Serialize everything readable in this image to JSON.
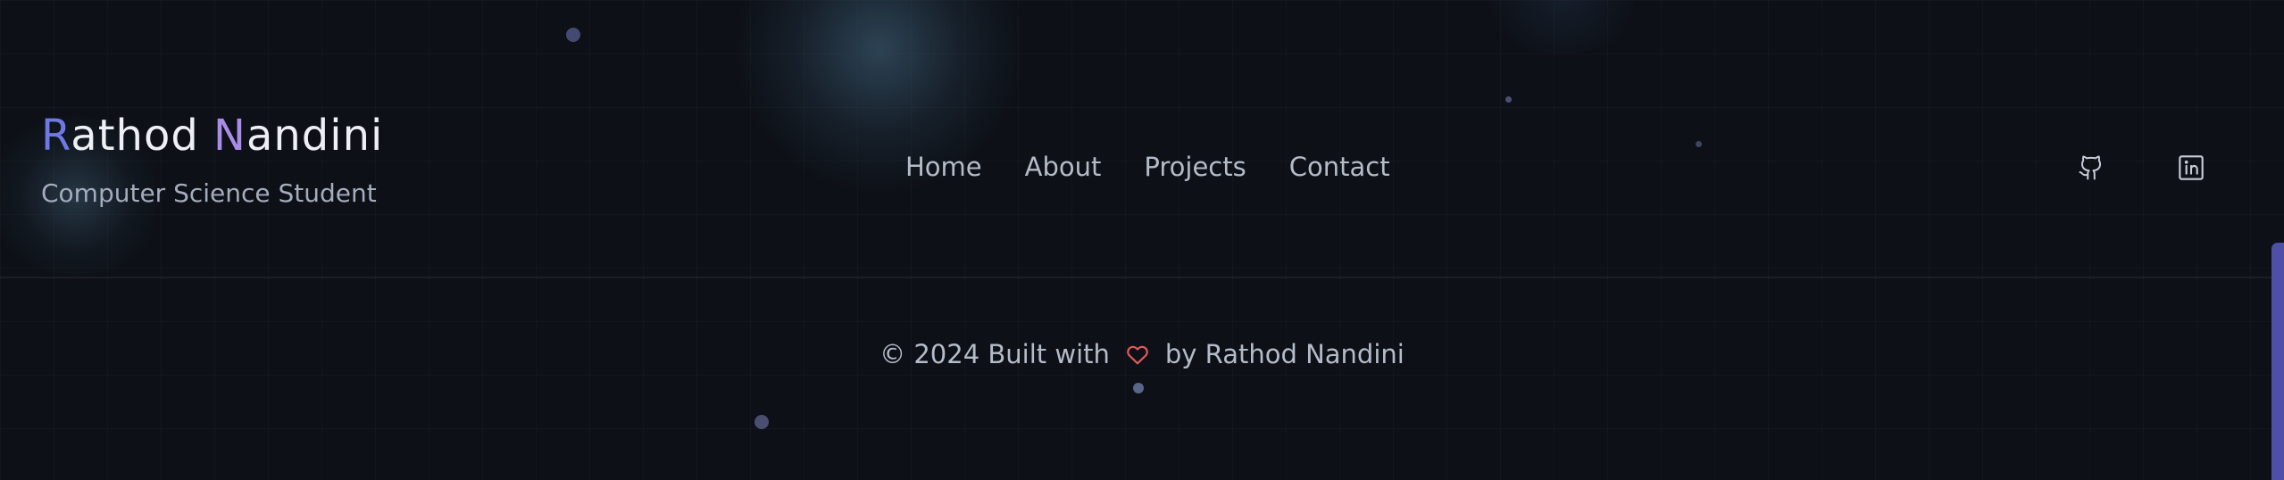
{
  "brand": {
    "name_first_initial": "R",
    "name_first_rest": "athod ",
    "name_last_initial": "N",
    "name_last_rest": "andini",
    "tagline": "Computer Science Student"
  },
  "nav": {
    "items": [
      {
        "label": "Home"
      },
      {
        "label": "About"
      },
      {
        "label": "Projects"
      },
      {
        "label": "Contact"
      }
    ]
  },
  "social": {
    "github_icon": "github-icon",
    "linkedin_icon": "linkedin-icon"
  },
  "footer": {
    "prefix": "© 2024 Built with",
    "heart_icon": "heart-icon",
    "suffix": "by Rathod Nandini"
  },
  "colors": {
    "background": "#0d1016",
    "accent_indigo": "#6f79e6",
    "accent_violet": "#a98be8",
    "heart": "#e05b5b",
    "scrollbar": "#4f4fa8",
    "text_muted": "#b4bbc9"
  }
}
